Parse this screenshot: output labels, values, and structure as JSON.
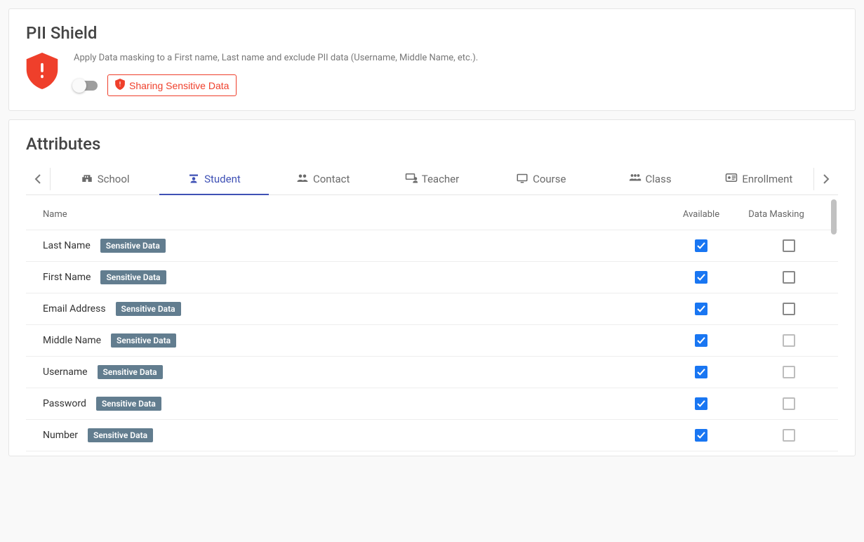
{
  "pii": {
    "title": "PII Shield",
    "description": "Apply Data masking to a First name, Last name and exclude PII data (Username, Middle Name, etc.).",
    "button_label": "Sharing Sensitive Data",
    "toggle_on": false
  },
  "attributes": {
    "title": "Attributes",
    "tabs": [
      {
        "label": "School",
        "icon": "school",
        "active": false
      },
      {
        "label": "Student",
        "icon": "student",
        "active": true
      },
      {
        "label": "Contact",
        "icon": "contact",
        "active": false
      },
      {
        "label": "Teacher",
        "icon": "teacher",
        "active": false
      },
      {
        "label": "Course",
        "icon": "course",
        "active": false
      },
      {
        "label": "Class",
        "icon": "class",
        "active": false
      },
      {
        "label": "Enrollment",
        "icon": "enrollment",
        "active": false
      }
    ],
    "columns": {
      "name": "Name",
      "available": "Available",
      "data_masking": "Data Masking"
    },
    "badge_label": "Sensitive Data",
    "rows": [
      {
        "name": "Last Name",
        "sensitive": true,
        "available": true,
        "masking": false,
        "mask_disabled": false
      },
      {
        "name": "First Name",
        "sensitive": true,
        "available": true,
        "masking": false,
        "mask_disabled": false
      },
      {
        "name": "Email Address",
        "sensitive": true,
        "available": true,
        "masking": false,
        "mask_disabled": false
      },
      {
        "name": "Middle Name",
        "sensitive": true,
        "available": true,
        "masking": false,
        "mask_disabled": true
      },
      {
        "name": "Username",
        "sensitive": true,
        "available": true,
        "masking": false,
        "mask_disabled": true
      },
      {
        "name": "Password",
        "sensitive": true,
        "available": true,
        "masking": false,
        "mask_disabled": true
      },
      {
        "name": "Number",
        "sensitive": true,
        "available": true,
        "masking": false,
        "mask_disabled": true
      }
    ]
  }
}
